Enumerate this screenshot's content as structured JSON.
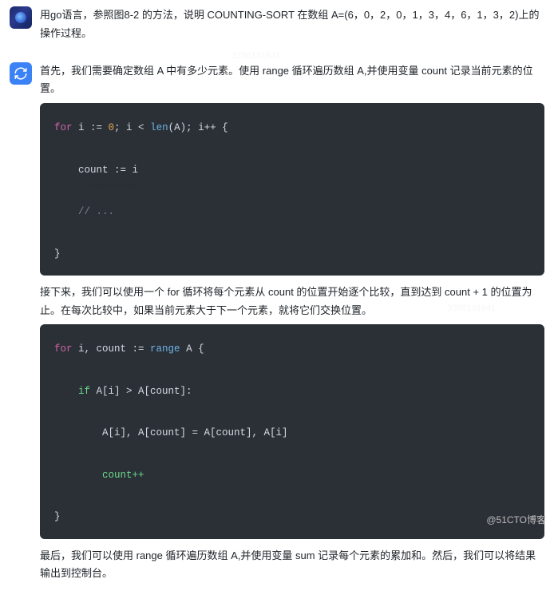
{
  "messages": [
    {
      "role": "user",
      "text": "用go语言，参照图8-2 的方法，说明 COUNTING-SORT 在数组 A=(6，0，2，0，1，3，4，6，1，3，2)上的操作过程。"
    },
    {
      "role": "bot",
      "paragraphs": [
        "首先，我们需要确定数组 A 中有多少元素。使用 range 循环遍历数组 A,并使用变量 count 记录当前元素的位置。",
        "接下来，我们可以使用一个 for 循环将每个元素从 count 的位置开始逐个比较，直到达到 count + 1 的位置为止。在每次比较中，如果当前元素大于下一个元素，就将它们交换位置。",
        "最后，我们可以使用 range 循环遍历数组 A,并使用变量 sum 记录每个元素的累加和。然后，我们可以将结果输出到控制台。"
      ],
      "code1": {
        "line1_for": "for",
        "line1_rest_a": " i := ",
        "line1_zero": "0",
        "line1_rest_b": "; i < ",
        "line1_len": "len",
        "line1_rest_c": "(A); i++ {",
        "line2": "    count := i",
        "line3": "    // ...",
        "line4": "}"
      },
      "code2": {
        "line1_for": "for",
        "line1_rest": " i, count := ",
        "line1_range": "range",
        "line1_rest2": " A {",
        "line2_if": "    if",
        "line2_rest": " A[i] > A[count]:",
        "line3": "        A[i], A[count] = A[count], A[i]",
        "line4_a": "        ",
        "line4_b": "count++",
        "line5": "}"
      }
    }
  ],
  "watermark": "@51CTO博客",
  "faint_id": "3286131641"
}
